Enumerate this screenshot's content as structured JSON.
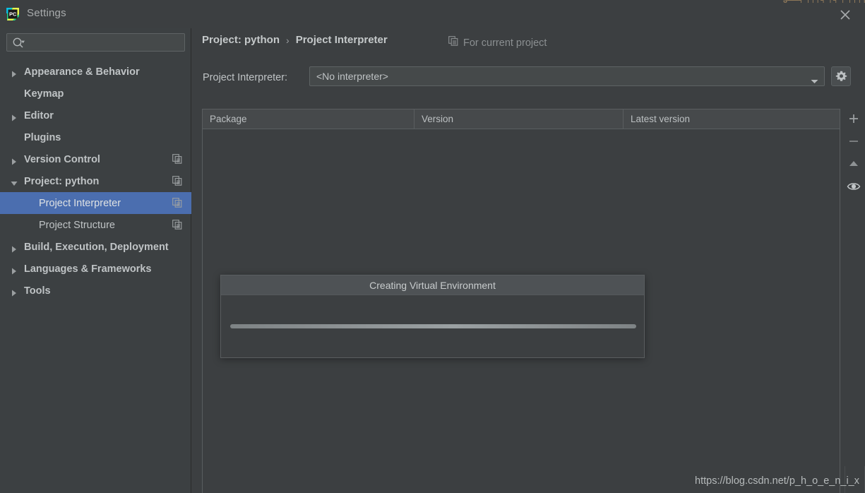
{
  "window": {
    "title": "Settings",
    "logo_icon": "pycharm-logo-icon",
    "close_icon": "close-icon",
    "top_stripe_text": "ə──┐ │││┐ │┐ │ ││││┐"
  },
  "search": {
    "value": "",
    "placeholder": "",
    "icon": "search-icon",
    "dropdown_icon": "chevron-down-icon"
  },
  "sidebar": {
    "items": [
      {
        "label": "Appearance & Behavior",
        "level": 1,
        "arrow": "collapsed",
        "scope_icon": false,
        "selected": false
      },
      {
        "label": "Keymap",
        "level": 1,
        "arrow": "none",
        "scope_icon": false,
        "selected": false
      },
      {
        "label": "Editor",
        "level": 1,
        "arrow": "collapsed",
        "scope_icon": false,
        "selected": false
      },
      {
        "label": "Plugins",
        "level": 1,
        "arrow": "none",
        "scope_icon": false,
        "selected": false
      },
      {
        "label": "Version Control",
        "level": 1,
        "arrow": "collapsed",
        "scope_icon": true,
        "selected": false
      },
      {
        "label": "Project: python",
        "level": 1,
        "arrow": "expanded",
        "scope_icon": true,
        "selected": false
      },
      {
        "label": "Project Interpreter",
        "level": 2,
        "arrow": "none",
        "scope_icon": true,
        "selected": true
      },
      {
        "label": "Project Structure",
        "level": 2,
        "arrow": "none",
        "scope_icon": true,
        "selected": false
      },
      {
        "label": "Build, Execution, Deployment",
        "level": 1,
        "arrow": "collapsed",
        "scope_icon": false,
        "selected": false
      },
      {
        "label": "Languages & Frameworks",
        "level": 1,
        "arrow": "collapsed",
        "scope_icon": false,
        "selected": false
      },
      {
        "label": "Tools",
        "level": 1,
        "arrow": "collapsed",
        "scope_icon": false,
        "selected": false
      }
    ]
  },
  "main": {
    "breadcrumb": [
      "Project: python",
      "Project Interpreter"
    ],
    "breadcrumb_separator": "›",
    "scope_hint": {
      "label": "For current project",
      "icon": "copy-settings-icon"
    },
    "interpreter": {
      "label": "Project Interpreter:",
      "value": "<No interpreter>",
      "placeholder": "<No interpreter>",
      "dropdown_icon": "chevron-down-icon",
      "options": [
        "<No interpreter>"
      ],
      "gear_icon": "gear-icon"
    },
    "packages_table": {
      "columns": [
        "Package",
        "Version",
        "Latest version"
      ],
      "rows": []
    },
    "side_buttons": [
      {
        "name": "add-package-button",
        "icon": "plus-icon",
        "glyph": "+"
      },
      {
        "name": "remove-package-button",
        "icon": "minus-icon",
        "glyph": "−"
      },
      {
        "name": "upgrade-package-button",
        "icon": "up-arrow-icon",
        "glyph": "▲"
      },
      {
        "name": "show-early-releases-button",
        "icon": "eye-icon",
        "glyph": "◉"
      }
    ]
  },
  "dialog": {
    "title": "Creating Virtual Environment",
    "progress": {
      "indeterminate": true,
      "percent": 100
    }
  },
  "watermark": {
    "text": "https://blog.csdn.net/p_h_o_e_n_i_x"
  },
  "colors": {
    "window_bg": "#3c3f41",
    "sidebar_bg": "#3c4042",
    "selection_blue": "#4b6eaf",
    "border": "#5a5e60",
    "text": "#bfc3c5",
    "text_dim": "#8b8f91",
    "header_bg": "#46494b",
    "dialog_header_bg": "#4e5255"
  }
}
